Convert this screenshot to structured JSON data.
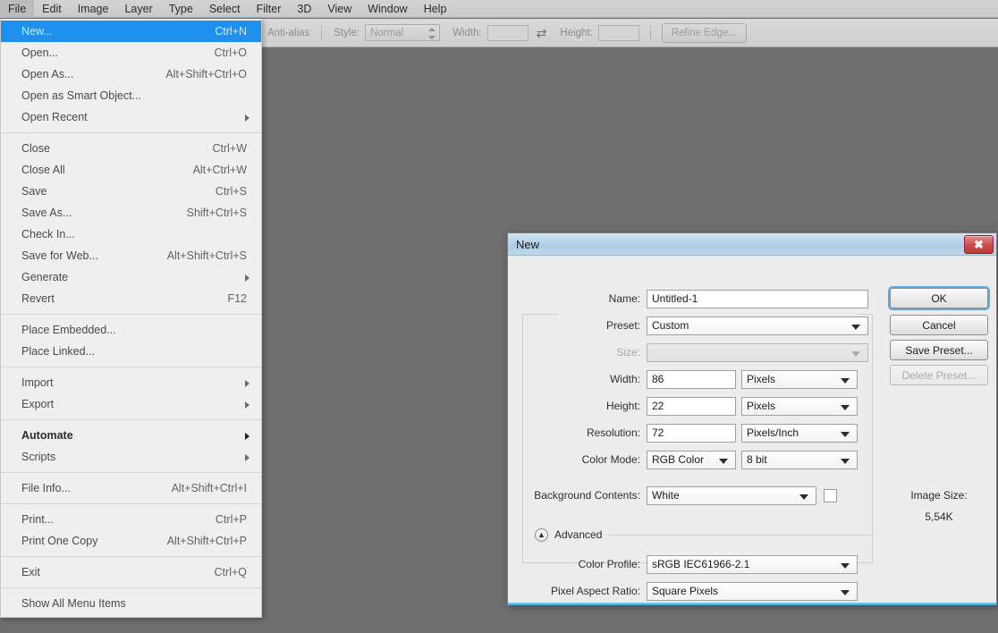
{
  "menubar": {
    "items": [
      {
        "label": "File",
        "active": true
      },
      {
        "label": "Edit",
        "active": false
      },
      {
        "label": "Image",
        "active": false
      },
      {
        "label": "Layer",
        "active": false
      },
      {
        "label": "Type",
        "active": false
      },
      {
        "label": "Select",
        "active": false
      },
      {
        "label": "Filter",
        "active": false
      },
      {
        "label": "3D",
        "active": false
      },
      {
        "label": "View",
        "active": false
      },
      {
        "label": "Window",
        "active": false
      },
      {
        "label": "Help",
        "active": false
      }
    ]
  },
  "options_bar": {
    "anti_alias_label": "Anti-alias",
    "style_label": "Style:",
    "style_value": "Normal",
    "width_label": "Width:",
    "width_value": "",
    "swap_icon": "swap-arrows-icon",
    "height_label": "Height:",
    "height_value": "",
    "refine_edge_label": "Refine Edge..."
  },
  "file_menu": {
    "groups": [
      [
        {
          "label": "New...",
          "shortcut": "Ctrl+N",
          "selected": true,
          "submenu": false,
          "bold": false
        },
        {
          "label": "Open...",
          "shortcut": "Ctrl+O",
          "selected": false,
          "submenu": false,
          "bold": false
        },
        {
          "label": "Open As...",
          "shortcut": "Alt+Shift+Ctrl+O",
          "selected": false,
          "submenu": false,
          "bold": false
        },
        {
          "label": "Open as Smart Object...",
          "shortcut": "",
          "selected": false,
          "submenu": false,
          "bold": false
        },
        {
          "label": "Open Recent",
          "shortcut": "",
          "selected": false,
          "submenu": true,
          "bold": false
        }
      ],
      [
        {
          "label": "Close",
          "shortcut": "Ctrl+W",
          "selected": false,
          "submenu": false,
          "bold": false
        },
        {
          "label": "Close All",
          "shortcut": "Alt+Ctrl+W",
          "selected": false,
          "submenu": false,
          "bold": false
        },
        {
          "label": "Save",
          "shortcut": "Ctrl+S",
          "selected": false,
          "submenu": false,
          "bold": false
        },
        {
          "label": "Save As...",
          "shortcut": "Shift+Ctrl+S",
          "selected": false,
          "submenu": false,
          "bold": false
        },
        {
          "label": "Check In...",
          "shortcut": "",
          "selected": false,
          "submenu": false,
          "bold": false
        },
        {
          "label": "Save for Web...",
          "shortcut": "Alt+Shift+Ctrl+S",
          "selected": false,
          "submenu": false,
          "bold": false
        },
        {
          "label": "Generate",
          "shortcut": "",
          "selected": false,
          "submenu": true,
          "bold": false
        },
        {
          "label": "Revert",
          "shortcut": "F12",
          "selected": false,
          "submenu": false,
          "bold": false
        }
      ],
      [
        {
          "label": "Place Embedded...",
          "shortcut": "",
          "selected": false,
          "submenu": false,
          "bold": false
        },
        {
          "label": "Place Linked...",
          "shortcut": "",
          "selected": false,
          "submenu": false,
          "bold": false
        }
      ],
      [
        {
          "label": "Import",
          "shortcut": "",
          "selected": false,
          "submenu": true,
          "bold": false
        },
        {
          "label": "Export",
          "shortcut": "",
          "selected": false,
          "submenu": true,
          "bold": false
        }
      ],
      [
        {
          "label": "Automate",
          "shortcut": "",
          "selected": false,
          "submenu": true,
          "bold": true
        },
        {
          "label": "Scripts",
          "shortcut": "",
          "selected": false,
          "submenu": true,
          "bold": false
        }
      ],
      [
        {
          "label": "File Info...",
          "shortcut": "Alt+Shift+Ctrl+I",
          "selected": false,
          "submenu": false,
          "bold": false
        }
      ],
      [
        {
          "label": "Print...",
          "shortcut": "Ctrl+P",
          "selected": false,
          "submenu": false,
          "bold": false
        },
        {
          "label": "Print One Copy",
          "shortcut": "Alt+Shift+Ctrl+P",
          "selected": false,
          "submenu": false,
          "bold": false
        }
      ],
      [
        {
          "label": "Exit",
          "shortcut": "Ctrl+Q",
          "selected": false,
          "submenu": false,
          "bold": false
        }
      ],
      [
        {
          "label": "Show All Menu Items",
          "shortcut": "",
          "selected": false,
          "submenu": false,
          "bold": false
        }
      ]
    ]
  },
  "dialog": {
    "title": "New",
    "close_icon": "close-icon",
    "fields": {
      "name_label": "Name:",
      "name_value": "Untitled-1",
      "preset_label": "Preset:",
      "preset_value": "Custom",
      "size_label": "Size:",
      "size_value": "",
      "width_label": "Width:",
      "width_value": "86",
      "width_unit": "Pixels",
      "height_label": "Height:",
      "height_value": "22",
      "height_unit": "Pixels",
      "resolution_label": "Resolution:",
      "resolution_value": "72",
      "resolution_unit": "Pixels/Inch",
      "color_mode_label": "Color Mode:",
      "color_mode_value": "RGB Color",
      "color_depth_value": "8 bit",
      "background_contents_label": "Background Contents:",
      "background_contents_value": "White",
      "color_profile_label": "Color Profile:",
      "color_profile_value": "sRGB IEC61966-2.1",
      "pixel_aspect_ratio_label": "Pixel Aspect Ratio:",
      "pixel_aspect_ratio_value": "Square Pixels"
    },
    "advanced": {
      "label": "Advanced",
      "toggle_icon": "chevron-up-circle-icon"
    },
    "buttons": {
      "ok": "OK",
      "cancel": "Cancel",
      "save_preset": "Save Preset...",
      "delete_preset": "Delete Preset..."
    },
    "image_size": {
      "label": "Image Size:",
      "value": "5,54K"
    }
  },
  "colors": {
    "selection_blue": "#1e90f0",
    "titlebar_blue": "#aecde6",
    "close_red": "#cb4b4b",
    "canvas_gray": "#6e6e6e",
    "focus_ring": "#63a7e8"
  }
}
